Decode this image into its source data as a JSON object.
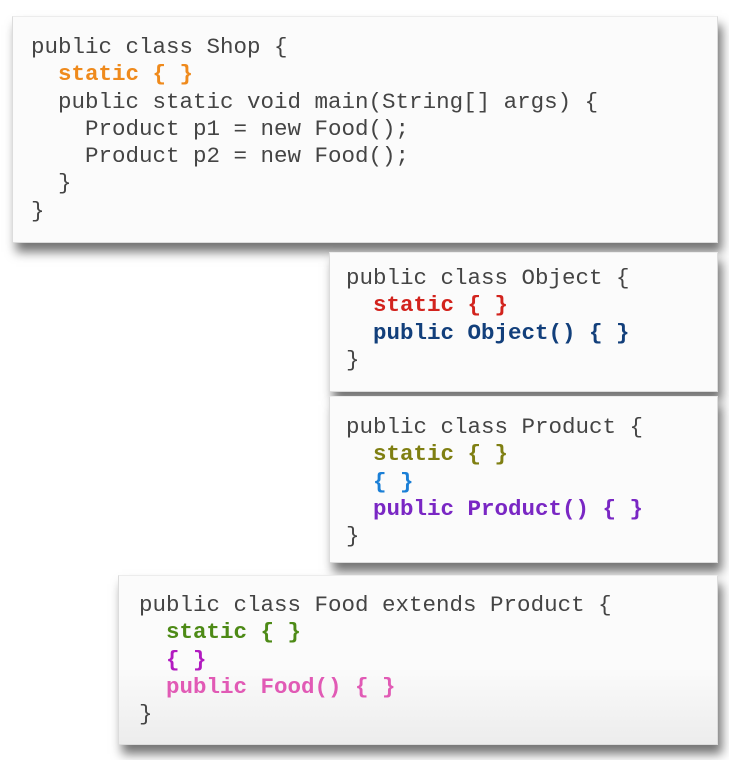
{
  "cards": {
    "shop": {
      "lines": [
        {
          "text": "public class Shop {",
          "color": null
        },
        {
          "text": "  static { }",
          "color": "#ef8a1c"
        },
        {
          "text": "  public static void main(String[] args) {",
          "color": null
        },
        {
          "text": "    Product p1 = new Food();",
          "color": null
        },
        {
          "text": "    Product p2 = new Food();",
          "color": null
        },
        {
          "text": "  }",
          "color": null
        },
        {
          "text": "}",
          "color": null
        }
      ]
    },
    "object": {
      "lines": [
        {
          "text": "public class Object {",
          "color": null
        },
        {
          "text": "  static { }",
          "color": "#d2231d"
        },
        {
          "text": "  public Object() { }",
          "color": "#123f7b"
        },
        {
          "text": "}",
          "color": null
        }
      ]
    },
    "product": {
      "lines": [
        {
          "text": "public class Product {",
          "color": null
        },
        {
          "text": "  static { }",
          "color": "#7f7f12"
        },
        {
          "text": "  { }",
          "color": "#1a7fd6"
        },
        {
          "text": "  public Product() { }",
          "color": "#7a27c4"
        },
        {
          "text": "}",
          "color": null
        }
      ]
    },
    "food": {
      "lines": [
        {
          "text": "public class Food extends Product {",
          "color": null
        },
        {
          "text": "  static { }",
          "color": "#4d8a16"
        },
        {
          "text": "  { }",
          "color": "#b21ac0"
        },
        {
          "text": "  public Food() { }",
          "color": "#e15ab5"
        },
        {
          "text": "}",
          "color": null
        }
      ]
    }
  },
  "default_text_color": "#444444"
}
